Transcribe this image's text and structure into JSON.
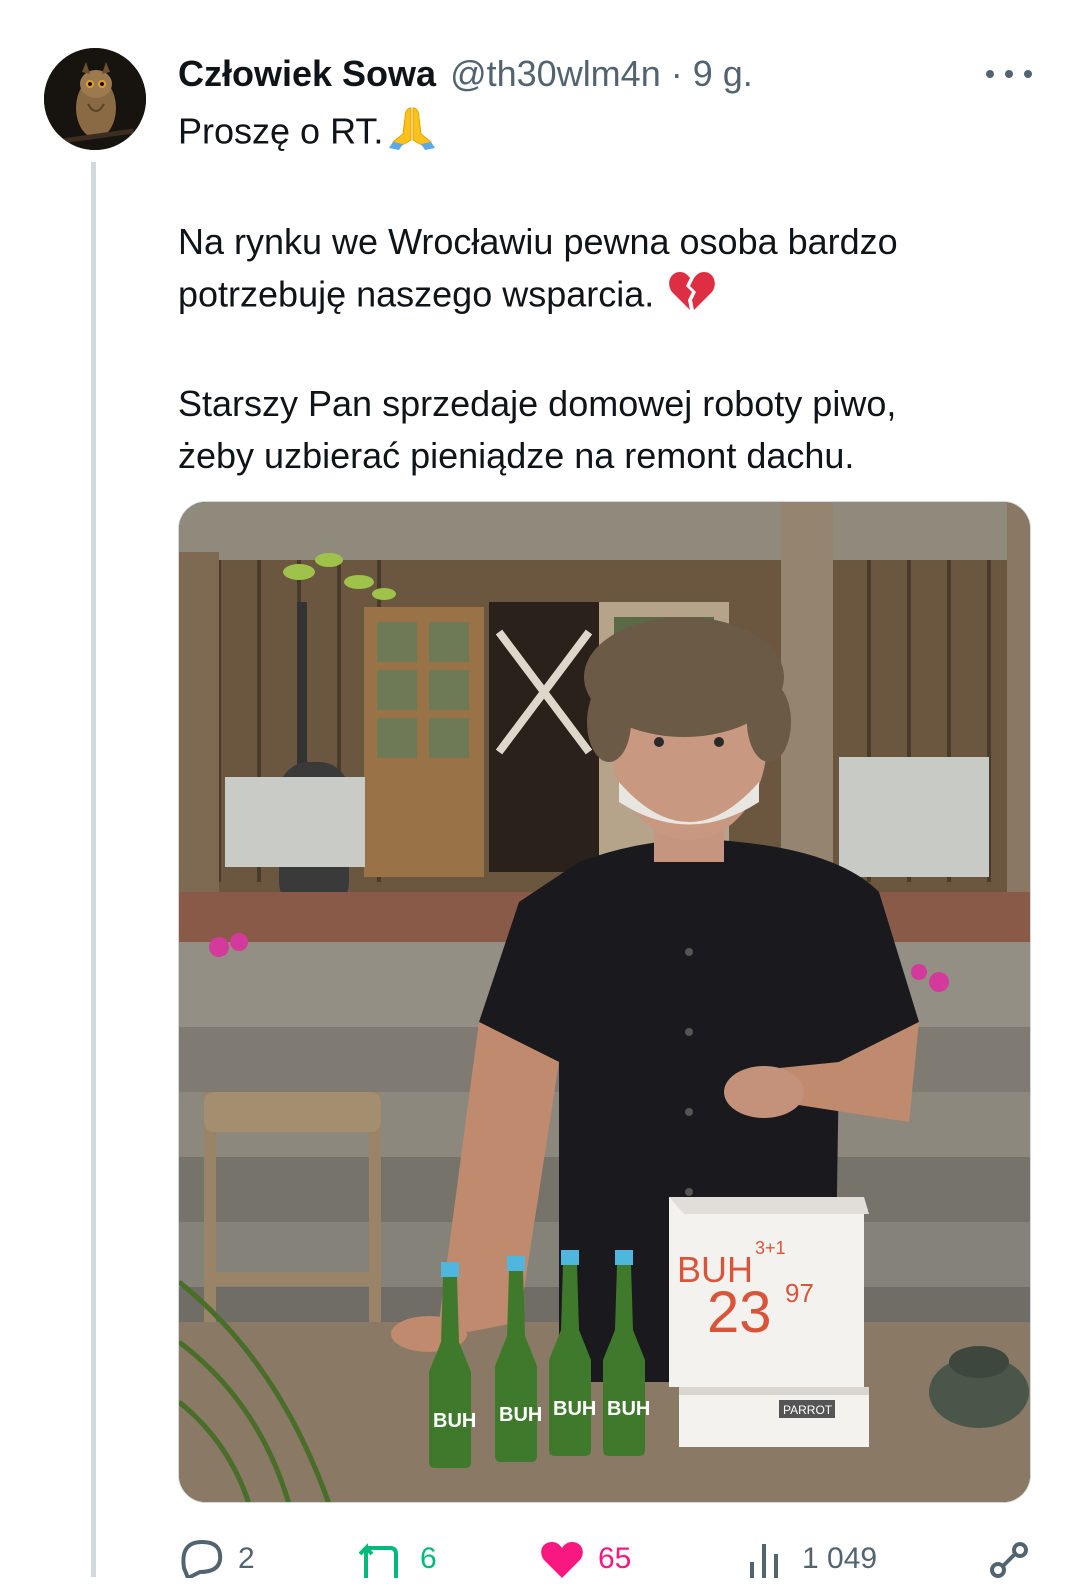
{
  "tweet": {
    "author": {
      "display_name": "Człowiek Sowa",
      "handle": "@th30wlm4n",
      "time": "9 g.",
      "avatar": "owl-photo"
    },
    "separator": "·",
    "text_lines": [
      "Proszę o RT.",
      "Na rynku we Wrocławiu pewna osoba bardzo",
      "potrzebuję naszego wsparcia.",
      "Starszy Pan sprzedaje domowej roboty piwo,",
      "żeby uzbierać pieniądze na remont dachu."
    ],
    "emojis": [
      "folded-hands",
      "broken-heart"
    ],
    "media": {
      "box_label_top": "BUH",
      "box_label_small": "3+1",
      "box_price": "23",
      "box_price_cents": "97",
      "bottle_label": "BUH",
      "bottle_count": 4,
      "paper_box_brand": "PARROT"
    },
    "actions": {
      "reply_count": "2",
      "retweet_count": "6",
      "like_count": "65",
      "views_count": "1 049"
    },
    "colors": {
      "text": "#0f1419",
      "secondary": "#536471",
      "retweet": "#00ba7c",
      "like": "#f91880"
    }
  }
}
